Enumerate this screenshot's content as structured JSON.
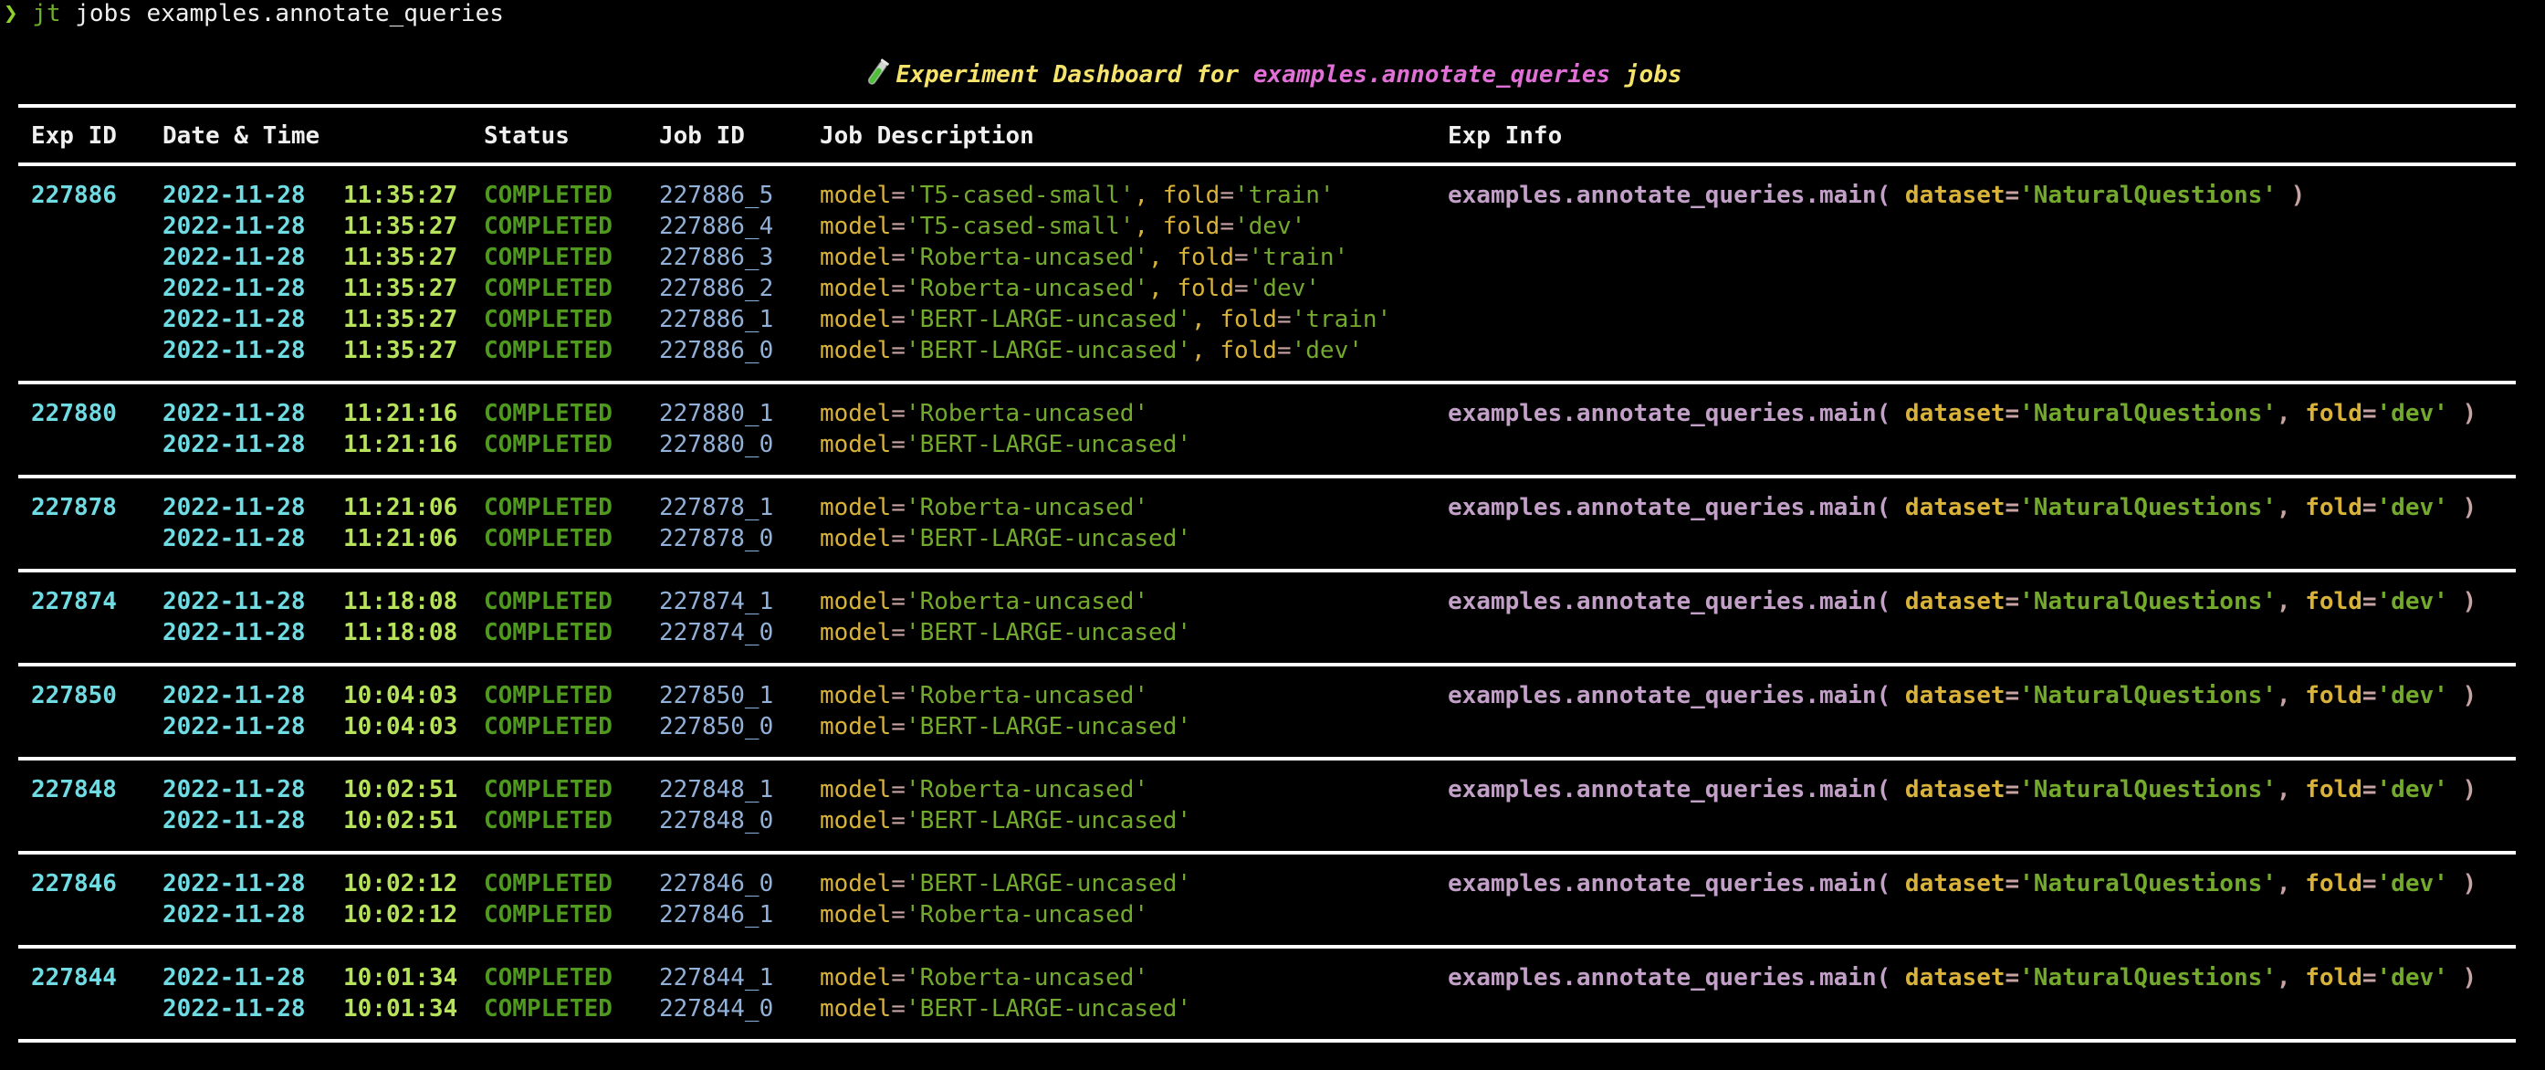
{
  "prompt": {
    "chevron": "❯",
    "command": "jt",
    "args": "jobs examples.annotate_queries"
  },
  "title": {
    "icon": "test-tube-icon",
    "prefix": "Experiment Dashboard for",
    "module": "examples.annotate_queries",
    "suffix": "jobs"
  },
  "colors": {
    "exp_id": "#6fdbe3",
    "date": "#6fdbe3",
    "time": "#b7e35a",
    "status": "#4f9a1e",
    "job_id": "#92b1d8",
    "key": "#d9b23a",
    "value": "#73a92c",
    "function": "#c2a0c8",
    "title_yellow": "#f5e36b",
    "title_magenta": "#e06fd6"
  },
  "table": {
    "headers": {
      "exp_id": "Exp ID",
      "date_time": "Date & Time",
      "status": "Status",
      "job_id": "Job ID",
      "job_description": "Job Description",
      "exp_info": "Exp Info"
    },
    "groups": [
      {
        "exp_id": "227886",
        "exp_info": {
          "func": "examples.annotate_queries.main(",
          "args": [
            {
              "k": "dataset",
              "v": "'NaturalQuestions'"
            }
          ],
          "close": " )"
        },
        "jobs": [
          {
            "date": "2022-11-28",
            "time": "11:35:27",
            "status": "COMPLETED",
            "job_id": "227886_5",
            "params": [
              {
                "k": "model",
                "v": "'T5-cased-small'"
              },
              {
                "k": "fold",
                "v": "'train'"
              }
            ]
          },
          {
            "date": "2022-11-28",
            "time": "11:35:27",
            "status": "COMPLETED",
            "job_id": "227886_4",
            "params": [
              {
                "k": "model",
                "v": "'T5-cased-small'"
              },
              {
                "k": "fold",
                "v": "'dev'"
              }
            ]
          },
          {
            "date": "2022-11-28",
            "time": "11:35:27",
            "status": "COMPLETED",
            "job_id": "227886_3",
            "params": [
              {
                "k": "model",
                "v": "'Roberta-uncased'"
              },
              {
                "k": "fold",
                "v": "'train'"
              }
            ]
          },
          {
            "date": "2022-11-28",
            "time": "11:35:27",
            "status": "COMPLETED",
            "job_id": "227886_2",
            "params": [
              {
                "k": "model",
                "v": "'Roberta-uncased'"
              },
              {
                "k": "fold",
                "v": "'dev'"
              }
            ]
          },
          {
            "date": "2022-11-28",
            "time": "11:35:27",
            "status": "COMPLETED",
            "job_id": "227886_1",
            "params": [
              {
                "k": "model",
                "v": "'BERT-LARGE-uncased'"
              },
              {
                "k": "fold",
                "v": "'train'"
              }
            ]
          },
          {
            "date": "2022-11-28",
            "time": "11:35:27",
            "status": "COMPLETED",
            "job_id": "227886_0",
            "params": [
              {
                "k": "model",
                "v": "'BERT-LARGE-uncased'"
              },
              {
                "k": "fold",
                "v": "'dev'"
              }
            ]
          }
        ]
      },
      {
        "exp_id": "227880",
        "exp_info": {
          "func": "examples.annotate_queries.main(",
          "args": [
            {
              "k": "dataset",
              "v": "'NaturalQuestions'"
            },
            {
              "k": "fold",
              "v": "'dev'"
            }
          ],
          "close": " )"
        },
        "jobs": [
          {
            "date": "2022-11-28",
            "time": "11:21:16",
            "status": "COMPLETED",
            "job_id": "227880_1",
            "params": [
              {
                "k": "model",
                "v": "'Roberta-uncased'"
              }
            ]
          },
          {
            "date": "2022-11-28",
            "time": "11:21:16",
            "status": "COMPLETED",
            "job_id": "227880_0",
            "params": [
              {
                "k": "model",
                "v": "'BERT-LARGE-uncased'"
              }
            ]
          }
        ]
      },
      {
        "exp_id": "227878",
        "exp_info": {
          "func": "examples.annotate_queries.main(",
          "args": [
            {
              "k": "dataset",
              "v": "'NaturalQuestions'"
            },
            {
              "k": "fold",
              "v": "'dev'"
            }
          ],
          "close": " )"
        },
        "jobs": [
          {
            "date": "2022-11-28",
            "time": "11:21:06",
            "status": "COMPLETED",
            "job_id": "227878_1",
            "params": [
              {
                "k": "model",
                "v": "'Roberta-uncased'"
              }
            ]
          },
          {
            "date": "2022-11-28",
            "time": "11:21:06",
            "status": "COMPLETED",
            "job_id": "227878_0",
            "params": [
              {
                "k": "model",
                "v": "'BERT-LARGE-uncased'"
              }
            ]
          }
        ]
      },
      {
        "exp_id": "227874",
        "exp_info": {
          "func": "examples.annotate_queries.main(",
          "args": [
            {
              "k": "dataset",
              "v": "'NaturalQuestions'"
            },
            {
              "k": "fold",
              "v": "'dev'"
            }
          ],
          "close": " )"
        },
        "jobs": [
          {
            "date": "2022-11-28",
            "time": "11:18:08",
            "status": "COMPLETED",
            "job_id": "227874_1",
            "params": [
              {
                "k": "model",
                "v": "'Roberta-uncased'"
              }
            ]
          },
          {
            "date": "2022-11-28",
            "time": "11:18:08",
            "status": "COMPLETED",
            "job_id": "227874_0",
            "params": [
              {
                "k": "model",
                "v": "'BERT-LARGE-uncased'"
              }
            ]
          }
        ]
      },
      {
        "exp_id": "227850",
        "exp_info": {
          "func": "examples.annotate_queries.main(",
          "args": [
            {
              "k": "dataset",
              "v": "'NaturalQuestions'"
            },
            {
              "k": "fold",
              "v": "'dev'"
            }
          ],
          "close": " )"
        },
        "jobs": [
          {
            "date": "2022-11-28",
            "time": "10:04:03",
            "status": "COMPLETED",
            "job_id": "227850_1",
            "params": [
              {
                "k": "model",
                "v": "'Roberta-uncased'"
              }
            ]
          },
          {
            "date": "2022-11-28",
            "time": "10:04:03",
            "status": "COMPLETED",
            "job_id": "227850_0",
            "params": [
              {
                "k": "model",
                "v": "'BERT-LARGE-uncased'"
              }
            ]
          }
        ]
      },
      {
        "exp_id": "227848",
        "exp_info": {
          "func": "examples.annotate_queries.main(",
          "args": [
            {
              "k": "dataset",
              "v": "'NaturalQuestions'"
            },
            {
              "k": "fold",
              "v": "'dev'"
            }
          ],
          "close": " )"
        },
        "jobs": [
          {
            "date": "2022-11-28",
            "time": "10:02:51",
            "status": "COMPLETED",
            "job_id": "227848_1",
            "params": [
              {
                "k": "model",
                "v": "'Roberta-uncased'"
              }
            ]
          },
          {
            "date": "2022-11-28",
            "time": "10:02:51",
            "status": "COMPLETED",
            "job_id": "227848_0",
            "params": [
              {
                "k": "model",
                "v": "'BERT-LARGE-uncased'"
              }
            ]
          }
        ]
      },
      {
        "exp_id": "227846",
        "exp_info": {
          "func": "examples.annotate_queries.main(",
          "args": [
            {
              "k": "dataset",
              "v": "'NaturalQuestions'"
            },
            {
              "k": "fold",
              "v": "'dev'"
            }
          ],
          "close": " )"
        },
        "jobs": [
          {
            "date": "2022-11-28",
            "time": "10:02:12",
            "status": "COMPLETED",
            "job_id": "227846_0",
            "params": [
              {
                "k": "model",
                "v": "'BERT-LARGE-uncased'"
              }
            ]
          },
          {
            "date": "2022-11-28",
            "time": "10:02:12",
            "status": "COMPLETED",
            "job_id": "227846_1",
            "params": [
              {
                "k": "model",
                "v": "'Roberta-uncased'"
              }
            ]
          }
        ]
      },
      {
        "exp_id": "227844",
        "exp_info": {
          "func": "examples.annotate_queries.main(",
          "args": [
            {
              "k": "dataset",
              "v": "'NaturalQuestions'"
            },
            {
              "k": "fold",
              "v": "'dev'"
            }
          ],
          "close": " )"
        },
        "jobs": [
          {
            "date": "2022-11-28",
            "time": "10:01:34",
            "status": "COMPLETED",
            "job_id": "227844_1",
            "params": [
              {
                "k": "model",
                "v": "'Roberta-uncased'"
              }
            ]
          },
          {
            "date": "2022-11-28",
            "time": "10:01:34",
            "status": "COMPLETED",
            "job_id": "227844_0",
            "params": [
              {
                "k": "model",
                "v": "'BERT-LARGE-uncased'"
              }
            ]
          }
        ]
      }
    ]
  }
}
